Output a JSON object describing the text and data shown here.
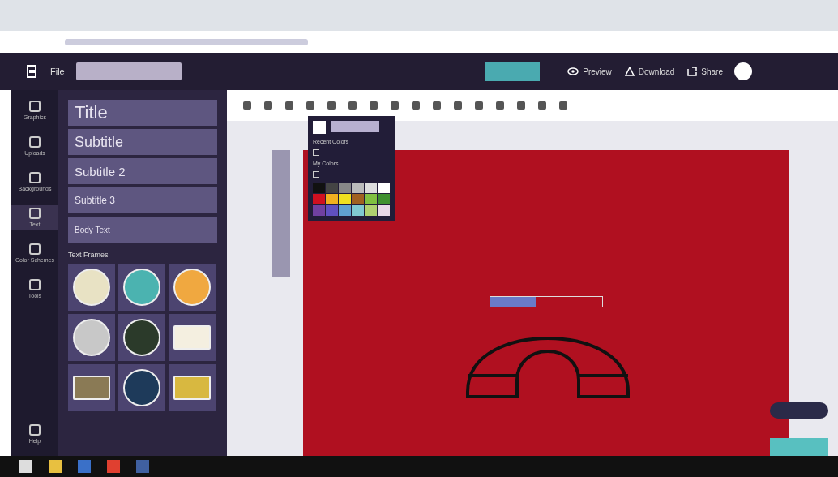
{
  "app_header": {
    "menu": "File",
    "actions": [
      {
        "label": "Preview",
        "kind": "eye"
      },
      {
        "label": "Download",
        "kind": "download"
      },
      {
        "label": "Share",
        "kind": "share"
      }
    ]
  },
  "sidebar": {
    "items": [
      {
        "label": "Graphics",
        "selected": false
      },
      {
        "label": "Uploads",
        "selected": false
      },
      {
        "label": "Backgrounds",
        "selected": false
      },
      {
        "label": "Text",
        "selected": true
      },
      {
        "label": "Color Schemes",
        "selected": false
      },
      {
        "label": "Tools",
        "selected": false
      }
    ],
    "help": "Help"
  },
  "text_panel": {
    "styles": [
      {
        "label": "Title",
        "kind": "title"
      },
      {
        "label": "Subtitle",
        "kind": "subtitle"
      },
      {
        "label": "Subtitle 2",
        "kind": "subtitle2"
      },
      {
        "label": "Subtitle 3",
        "kind": "subtitle3"
      },
      {
        "label": "Body Text",
        "kind": "body"
      }
    ],
    "frames_heading": "Text Frames"
  },
  "color_picker": {
    "recent_heading": "Recent Colors",
    "my_heading": "My Colors"
  }
}
